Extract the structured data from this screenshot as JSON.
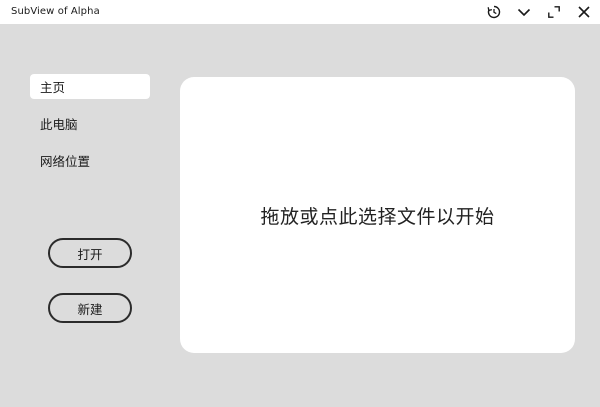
{
  "window": {
    "title": "SubView of Alpha",
    "controls": [
      "history-icon",
      "chevron-down-icon",
      "maximize-icon",
      "close-icon"
    ]
  },
  "sidebar": {
    "items": [
      {
        "label": "主页",
        "active": true
      },
      {
        "label": "此电脑",
        "active": false
      },
      {
        "label": "网络位置",
        "active": false
      }
    ]
  },
  "actions": {
    "open_label": "打开",
    "new_label": "新建"
  },
  "drop_zone": {
    "text": "拖放或点此选择文件以开始"
  },
  "colors": {
    "background": "#dcdcdc",
    "panel": "#ffffff",
    "text": "#1a1a1a",
    "button_border": "#2b2b2b"
  }
}
